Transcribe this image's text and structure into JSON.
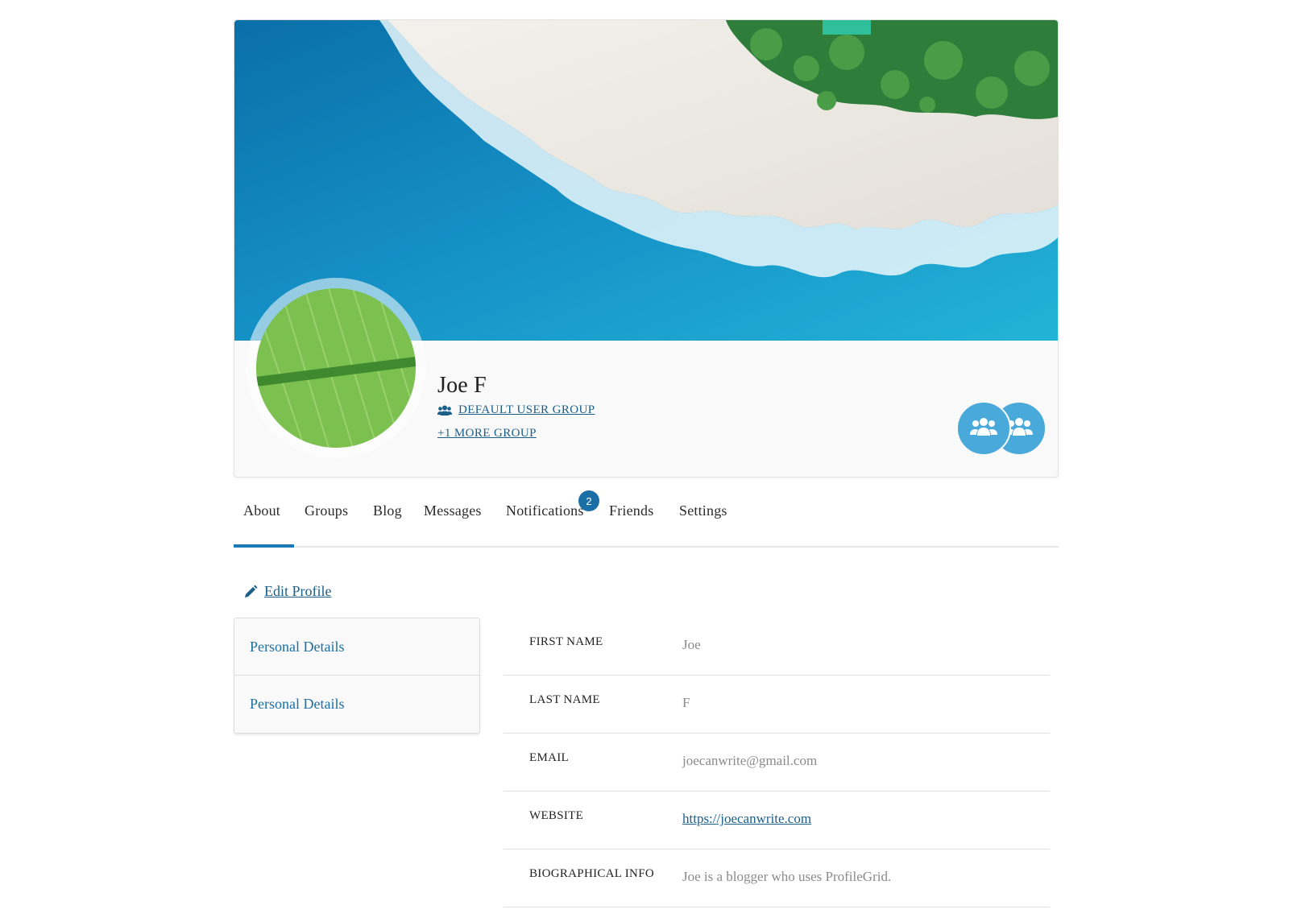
{
  "profile": {
    "name": "Joe F",
    "primary_group": "DEFAULT USER GROUP",
    "more_groups": "+1 MORE GROUP",
    "cover_image": "tropical beach aerial cover photo",
    "avatar_image": "green leaf avatar"
  },
  "tabs": [
    {
      "label": "About",
      "active": true
    },
    {
      "label": "Groups"
    },
    {
      "label": "Blog"
    },
    {
      "label": "Messages"
    },
    {
      "label": "Notifications",
      "badge": "2"
    },
    {
      "label": "Friends"
    },
    {
      "label": "Settings"
    }
  ],
  "edit_profile_label": "Edit Profile",
  "sections": [
    {
      "label": "Personal Details"
    },
    {
      "label": "Personal Details"
    }
  ],
  "fields": [
    {
      "label": "FIRST NAME",
      "value": "Joe"
    },
    {
      "label": "LAST NAME",
      "value": "F"
    },
    {
      "label": "EMAIL",
      "value": "joecanwrite@gmail.com"
    },
    {
      "label": "WEBSITE",
      "value": "https://joecanwrite.com"
    },
    {
      "label": "BIOGRAPHICAL INFO",
      "value": "Joe is a blogger who uses ProfileGrid."
    }
  ],
  "colors": {
    "accent": "#1a7ab8",
    "link": "#1a5e8a",
    "group_badge": "#4aa9db"
  },
  "icons": [
    "users-icon",
    "group-icon",
    "pencil-icon"
  ]
}
